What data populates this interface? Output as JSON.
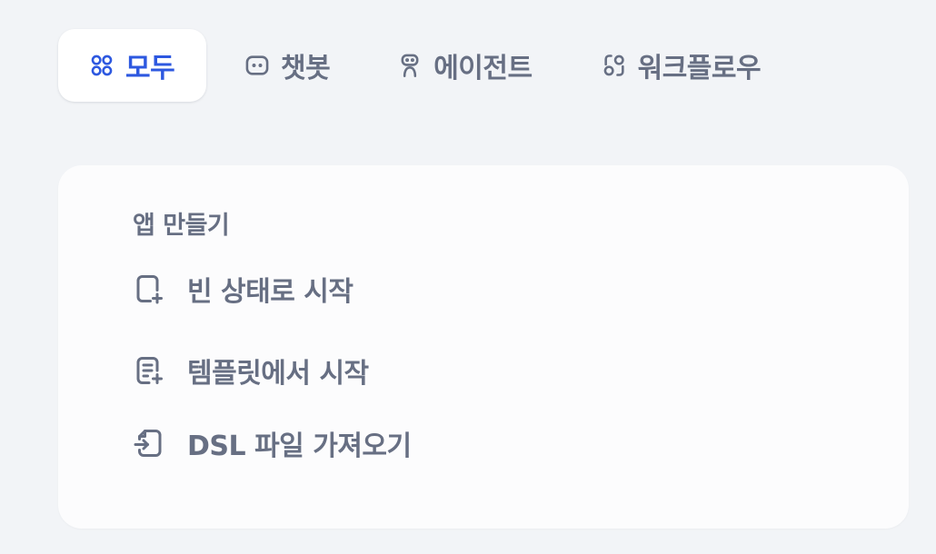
{
  "tabs": [
    {
      "label": "모두",
      "icon": "grid-four-circles-icon",
      "active": true
    },
    {
      "label": "챗봇",
      "icon": "chat-bubble-icon",
      "active": false
    },
    {
      "label": "에이전트",
      "icon": "robot-icon",
      "active": false
    },
    {
      "label": "워크플로우",
      "icon": "workflow-icon",
      "active": false
    }
  ],
  "create_app": {
    "title": "앱 만들기",
    "items": [
      {
        "label": "빈 상태로 시작",
        "icon": "file-plus-icon"
      },
      {
        "label": "템플릿에서 시작",
        "icon": "file-text-plus-icon"
      },
      {
        "label": "DSL 파일 가져오기",
        "icon": "file-import-icon"
      }
    ]
  },
  "colors": {
    "accent": "#2d58e0",
    "text_muted": "#676f83",
    "background": "#f2f4f7",
    "card": "#fcfcfd"
  }
}
